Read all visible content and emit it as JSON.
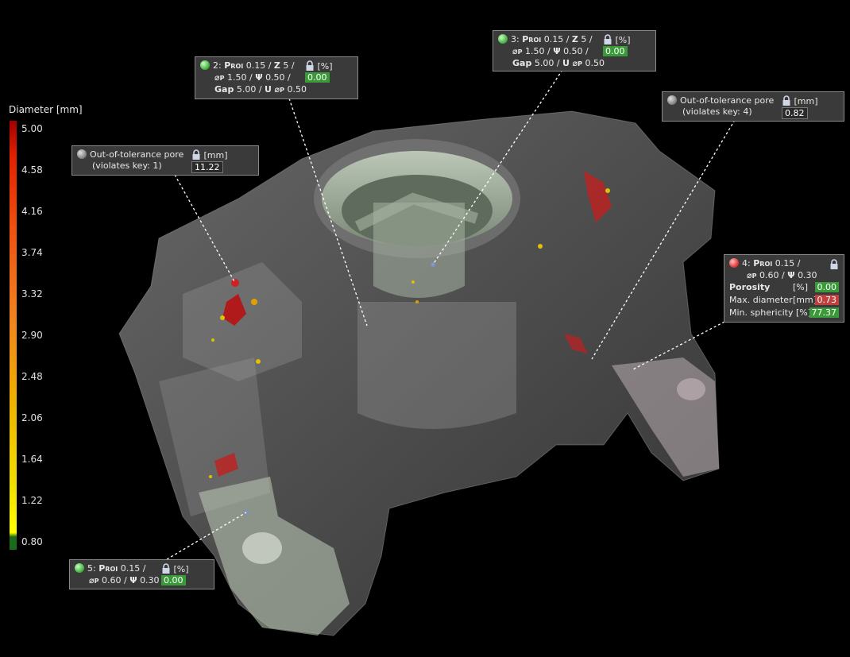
{
  "legend": {
    "title": "Diameter [mm]",
    "ticks": [
      "5.00",
      "4.58",
      "4.16",
      "3.74",
      "3.32",
      "2.90",
      "2.48",
      "2.06",
      "1.64",
      "1.22",
      "0.80"
    ]
  },
  "cards": {
    "c2": {
      "key": "2:",
      "p": "P",
      "roi": "ROI",
      "p_val": "0.15 /",
      "z": "Z",
      "z_val": "5 /",
      "phi": "⌀",
      "phi_sub": "P",
      "phi_val": "1.50 /",
      "psi": "Ψ",
      "psi_val": "0.50 /",
      "gap": "Gap",
      "gap_val": "5.00 /",
      "u": "U",
      "u_val": "0.50",
      "unit": "[%]",
      "value": "0.00"
    },
    "c3": {
      "key": "3:",
      "p": "P",
      "roi": "ROI",
      "p_val": "0.15 /",
      "z": "Z",
      "z_val": "5 /",
      "phi": "⌀",
      "phi_sub": "P",
      "phi_val": "1.50 /",
      "psi": "Ψ",
      "psi_val": "0.50 /",
      "gap": "Gap",
      "gap_val": "5.00 /",
      "u": "U",
      "u_val": "0.50",
      "unit": "[%]",
      "value": "0.00"
    },
    "c1": {
      "line1": "Out-of-tolerance pore",
      "line2": "(violates key: 1)",
      "unit": "[mm]",
      "value": "11.22"
    },
    "c4oot": {
      "line1": "Out-of-tolerance pore",
      "line2": "(violates key: 4)",
      "unit": "[mm]",
      "value": "0.82"
    },
    "c4": {
      "key": "4:",
      "p": "P",
      "roi": "ROI",
      "p_val": "0.15 /",
      "phi": "⌀",
      "phi_sub": "P",
      "phi_val": "0.60 /",
      "psi": "Ψ",
      "psi_val": "0.30",
      "rows": [
        {
          "label": "Porosity",
          "unit": "[%]",
          "value": "0.00",
          "status": "green"
        },
        {
          "label": "Max. diameter",
          "unit": "[mm]",
          "value": "0.73",
          "status": "red"
        },
        {
          "label": "Min. sphericity",
          "unit": "[%]",
          "value": "77.37",
          "status": "green"
        }
      ]
    },
    "c5": {
      "key": "5:",
      "p": "P",
      "roi": "ROI",
      "p_val": "0.15 /",
      "phi": "⌀",
      "phi_sub": "P",
      "phi_val": "0.60 /",
      "psi": "Ψ",
      "psi_val": "0.30",
      "unit": "[%]",
      "value": "0.00"
    }
  },
  "colors": {
    "pass": "#3a9a3a",
    "fail": "#c04040",
    "panel": "#3a3a3a"
  }
}
